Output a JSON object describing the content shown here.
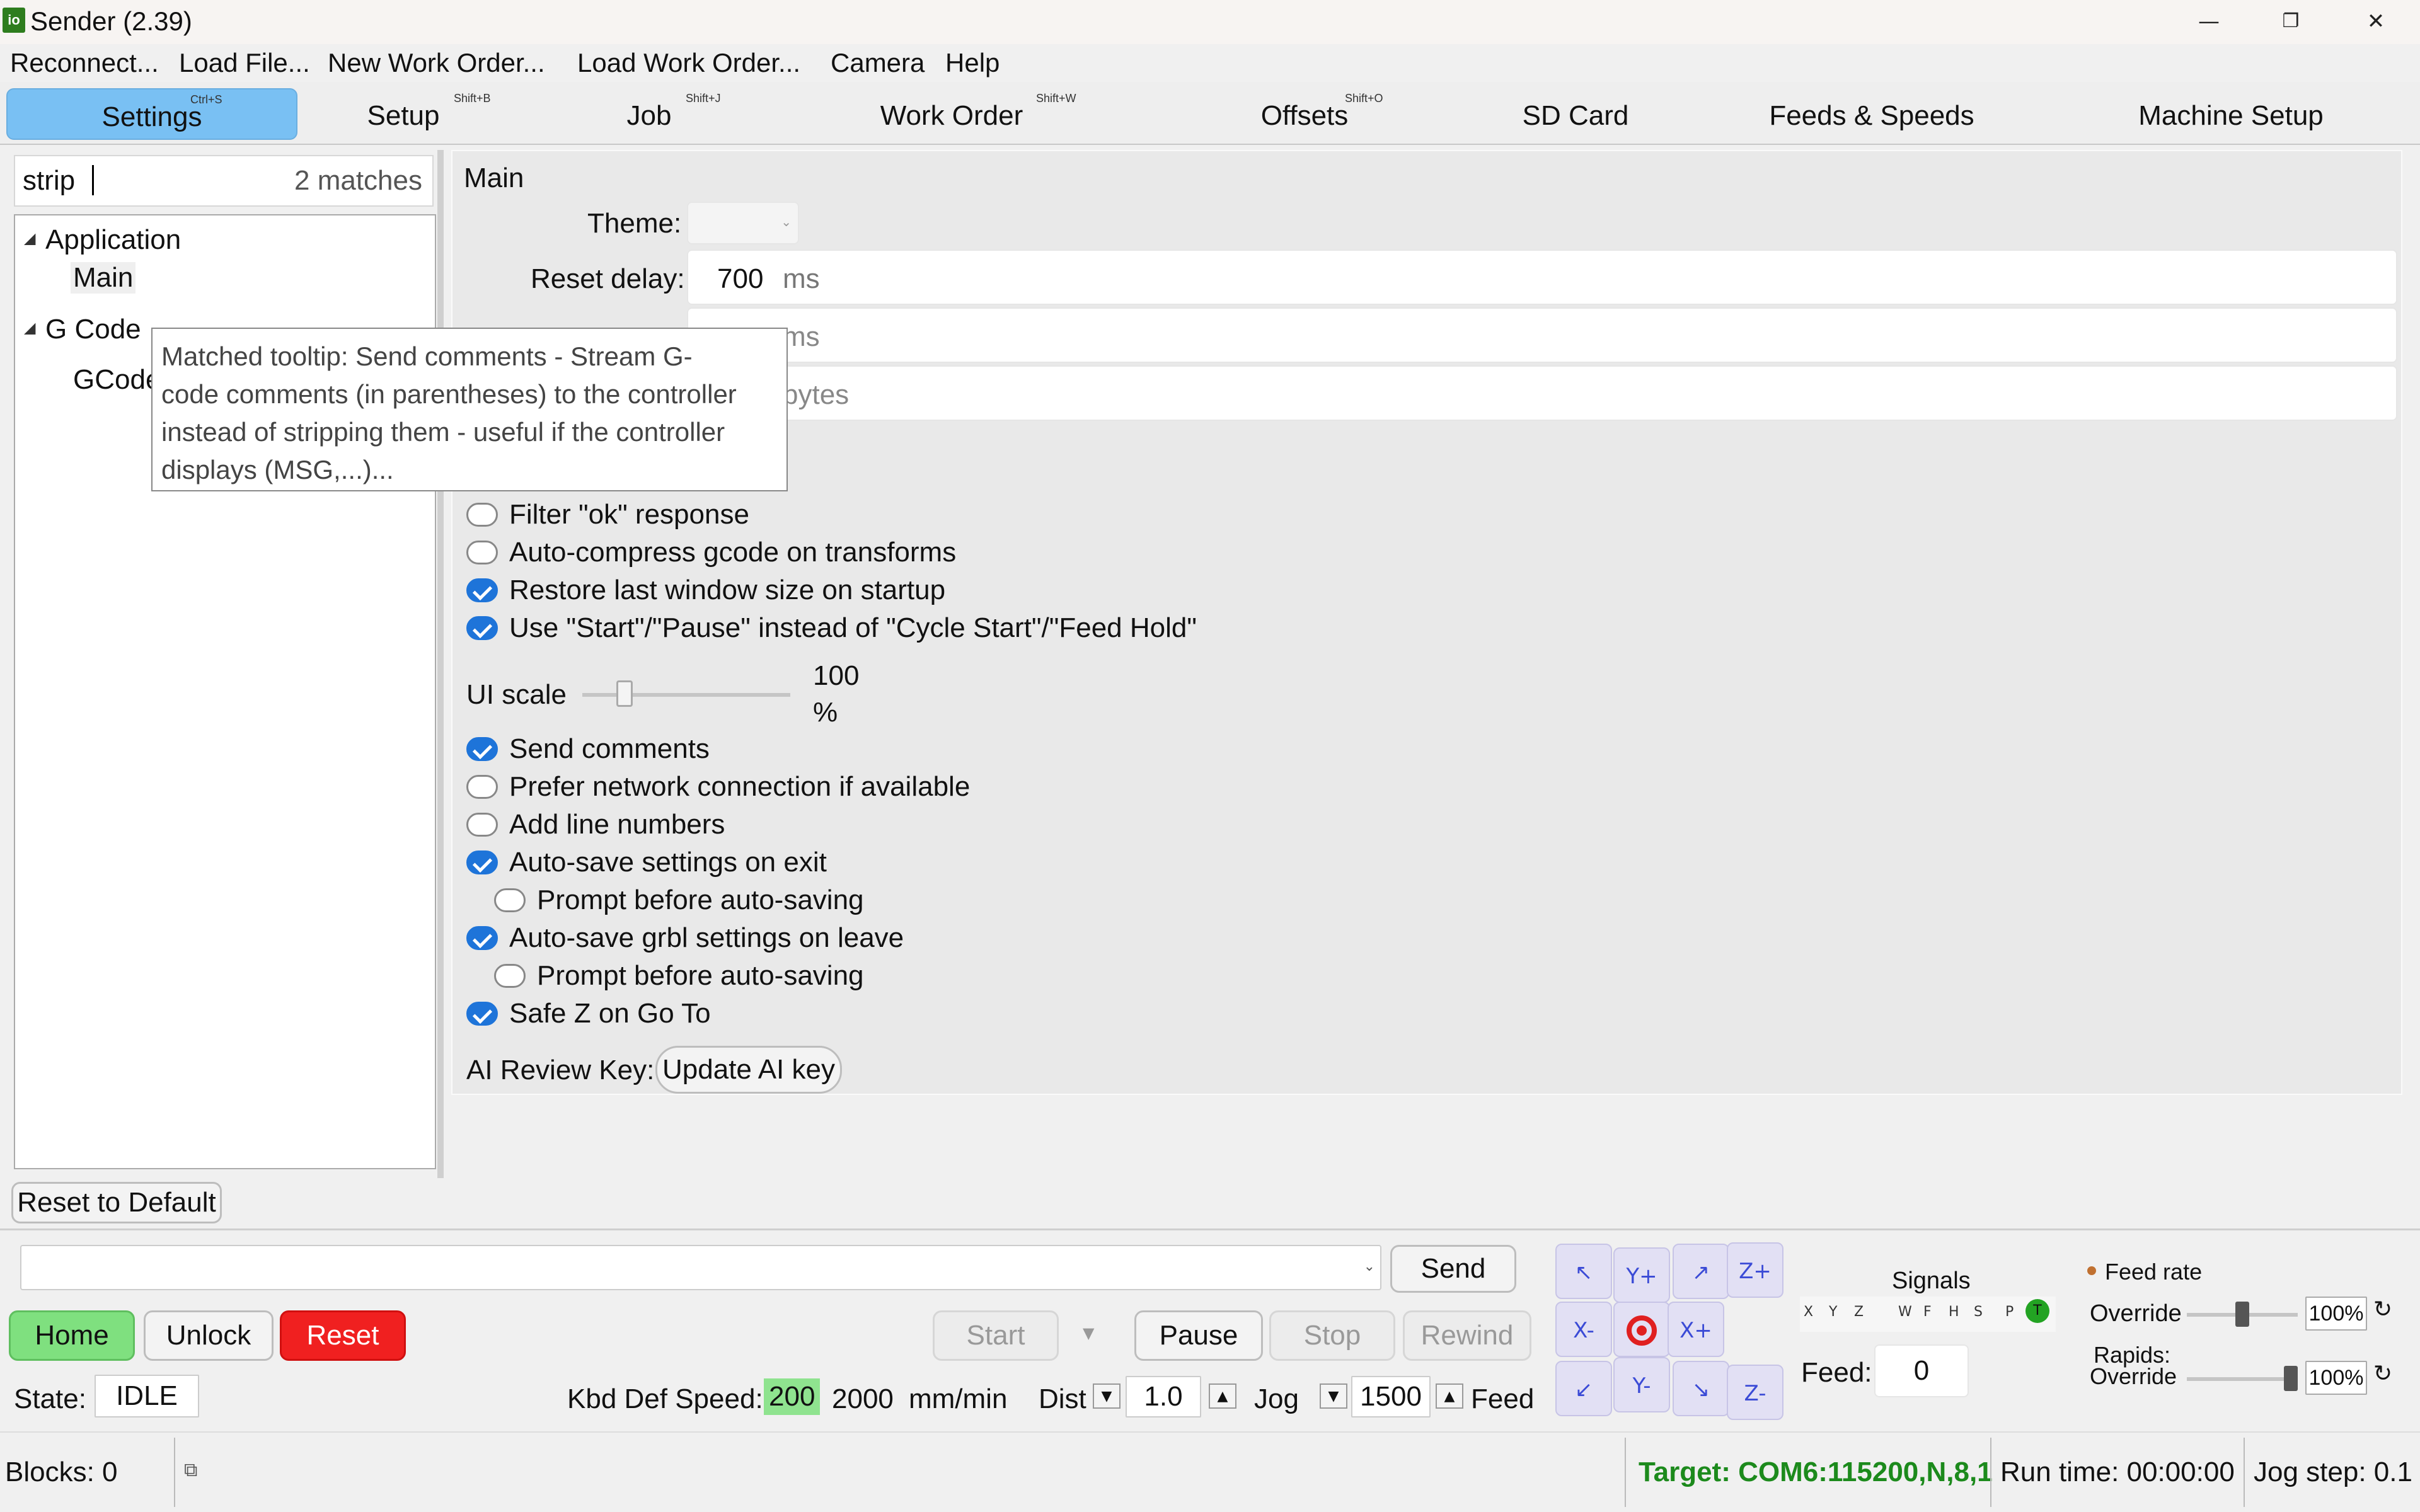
{
  "window": {
    "title": "Sender (2.39)",
    "app_icon": "io"
  },
  "menu": [
    "Reconnect...",
    "Load File...",
    "New Work Order...",
    "Load Work Order...",
    "Camera",
    "Help"
  ],
  "tabs": [
    {
      "label": "Settings",
      "shortcut": "Ctrl+S"
    },
    {
      "label": "Setup",
      "shortcut": "Shift+B"
    },
    {
      "label": "Job",
      "shortcut": "Shift+J"
    },
    {
      "label": "Work Order",
      "shortcut": "Shift+W"
    },
    {
      "label": "Offsets",
      "shortcut": "Shift+O"
    },
    {
      "label": "SD Card",
      "shortcut": ""
    },
    {
      "label": "Feeds & Speeds",
      "shortcut": ""
    },
    {
      "label": "Machine Setup",
      "shortcut": ""
    }
  ],
  "search": {
    "value": "strip",
    "matches": "2 matches"
  },
  "tree": {
    "group1": "Application",
    "item1": "Main",
    "group2": "G Code",
    "item2": "GCode"
  },
  "tooltip": [
    "Matched tooltip: Send comments - Stream G-",
    "code comments (in parentheses) to the controller",
    "instead of stripping them - useful if the controller",
    "displays (MSG,...)..."
  ],
  "section": {
    "title": "Main",
    "theme_label": "Theme:",
    "reset_delay_label": "Reset delay:",
    "reset_delay_value": "700",
    "reset_delay_unit": "ms",
    "partial_unit1": "ms",
    "partial_unit2": "bytes",
    "checkboxes": [
      {
        "label": "Filter \"ok\" response",
        "checked": false
      },
      {
        "label": "Auto-compress gcode on transforms",
        "checked": false
      },
      {
        "label": "Restore last window size on startup",
        "checked": true
      },
      {
        "label": "Use \"Start\"/\"Pause\" instead of \"Cycle Start\"/\"Feed Hold\"",
        "checked": true
      }
    ],
    "ui_scale_label": "UI scale",
    "ui_scale_value": "100",
    "ui_scale_unit": "%",
    "checkboxes2": [
      {
        "label": "Send comments",
        "checked": true,
        "indent": false
      },
      {
        "label": "Prefer network connection if available",
        "checked": false,
        "indent": false
      },
      {
        "label": "Add line numbers",
        "checked": false,
        "indent": false
      },
      {
        "label": "Auto-save settings on exit",
        "checked": true,
        "indent": false
      },
      {
        "label": "Prompt before auto-saving",
        "checked": false,
        "indent": true
      },
      {
        "label": "Auto-save grbl settings on leave",
        "checked": true,
        "indent": false
      },
      {
        "label": "Prompt before auto-saving",
        "checked": false,
        "indent": true
      },
      {
        "label": "Safe Z on Go To",
        "checked": true,
        "indent": false
      }
    ],
    "ai_key_label": "AI Review Key:",
    "ai_key_button": "Update AI key"
  },
  "reset_default": "Reset to Default",
  "console": {
    "send": "Send"
  },
  "buttons": {
    "home": "Home",
    "unlock": "Unlock",
    "reset": "Reset",
    "start": "Start",
    "pause": "Pause",
    "stop": "Stop",
    "rewind": "Rewind"
  },
  "colors": {
    "home": "#7fe07f",
    "reset": "#f02020",
    "accent": "#79c0f3",
    "check": "#1e74d9",
    "target": "#1c8a1c"
  },
  "state": {
    "label": "State:",
    "value": "IDLE"
  },
  "kbd": {
    "label": "Kbd Def Speed:",
    "speed_slow": "200",
    "speed_fast": "2000",
    "unit": "mm/min",
    "dist_label": "Dist",
    "dist_value": "1.0",
    "jog_label": "Jog",
    "jog_value": "1500",
    "feed_label": "Feed"
  },
  "jog_buttons": [
    "Y+",
    "Z+",
    "X-",
    "X+",
    "Y-",
    "Z-"
  ],
  "signals": {
    "title": "Signals",
    "letters": [
      "X",
      "Y",
      "Z",
      "W",
      "F",
      "H",
      "S",
      "P",
      "T"
    ]
  },
  "feed": {
    "label": "Feed:",
    "value": "0"
  },
  "override": {
    "feed_rate": "Feed rate",
    "override": "Override",
    "feed_pct": "100%",
    "rapids": "Rapids:",
    "rapids_override": "Override",
    "rapids_pct": "100%",
    "feed_level": 0.5,
    "rapids_level": 1.0
  },
  "statusbar": {
    "blocks": "Blocks: 0",
    "target": "Target: COM6:115200,N,8,1",
    "runtime": "Run time: 00:00:00",
    "jogstep": "Jog step: 0.1"
  }
}
